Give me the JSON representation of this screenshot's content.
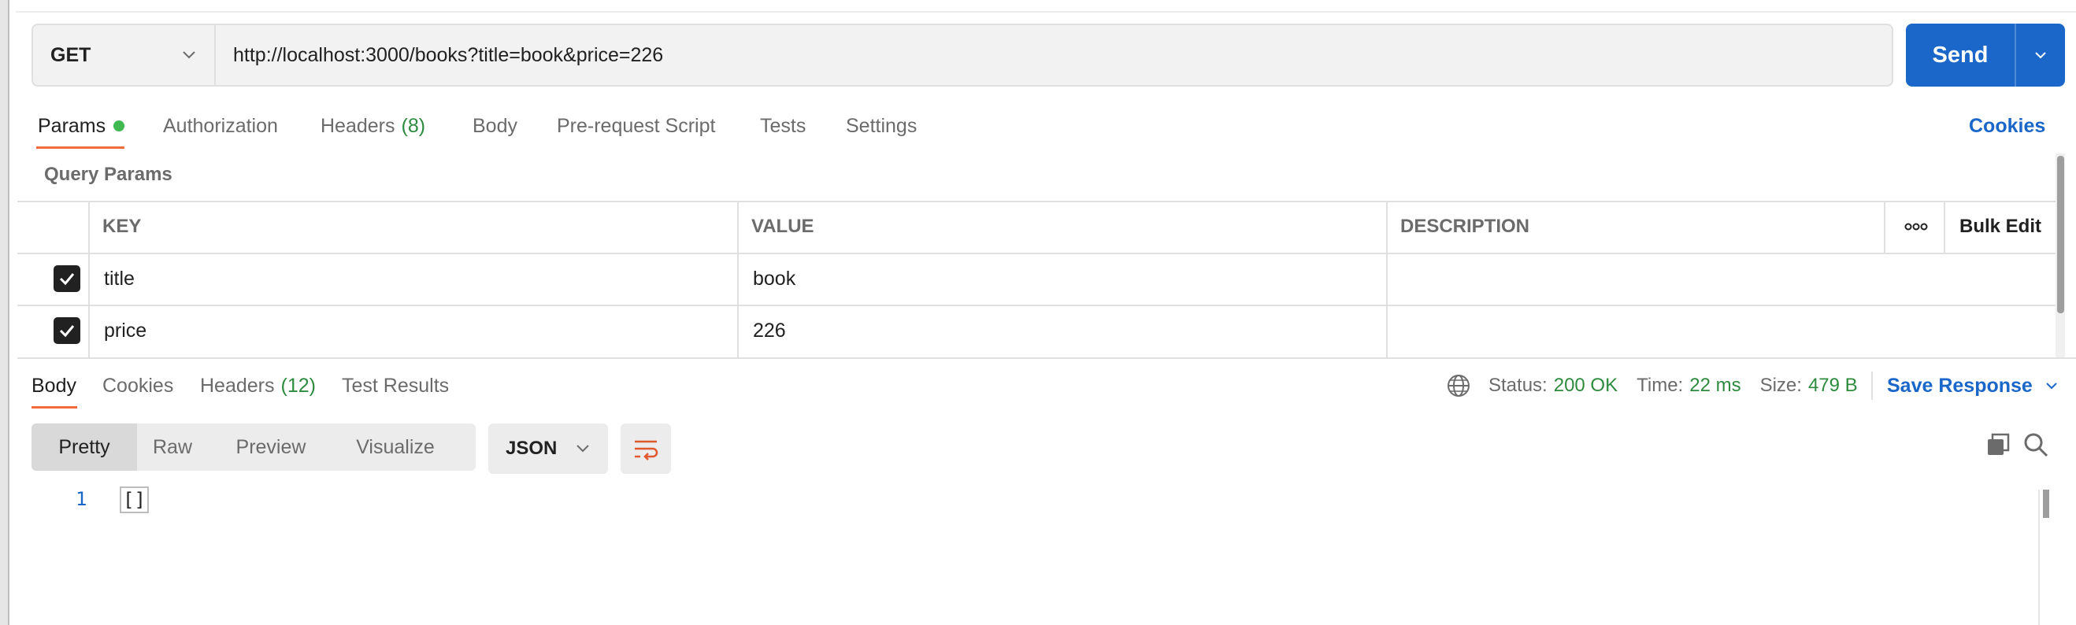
{
  "request": {
    "method": "GET",
    "url": "http://localhost:3000/books?title=book&price=226",
    "send_label": "Send"
  },
  "request_tabs": [
    {
      "label": "Params",
      "active": true,
      "has_dot": true
    },
    {
      "label": "Authorization"
    },
    {
      "label": "Headers",
      "count": "(8)"
    },
    {
      "label": "Body"
    },
    {
      "label": "Pre-request Script"
    },
    {
      "label": "Tests"
    },
    {
      "label": "Settings"
    }
  ],
  "cookies_label": "Cookies",
  "query_params": {
    "label": "Query Params",
    "headers": {
      "key": "KEY",
      "value": "VALUE",
      "description": "DESCRIPTION",
      "bulk_edit": "Bulk Edit"
    },
    "rows": [
      {
        "checked": true,
        "key": "title",
        "value": "book",
        "description": ""
      },
      {
        "checked": true,
        "key": "price",
        "value": "226",
        "description": ""
      }
    ]
  },
  "response_tabs": [
    {
      "label": "Body",
      "active": true
    },
    {
      "label": "Cookies"
    },
    {
      "label": "Headers",
      "count": "(12)"
    },
    {
      "label": "Test Results"
    }
  ],
  "response_status": {
    "status_label": "Status:",
    "status_value": "200 OK",
    "time_label": "Time:",
    "time_value": "22 ms",
    "size_label": "Size:",
    "size_value": "479 B",
    "save_label": "Save Response"
  },
  "view_modes": [
    "Pretty",
    "Raw",
    "Preview",
    "Visualize"
  ],
  "active_view": "Pretty",
  "format": "JSON",
  "code": {
    "line_number": "1",
    "content": "[]"
  },
  "colors": {
    "accent": "#1a67c9",
    "tab_indicator": "#f26b3a",
    "success": "#2e8b3e",
    "dot": "#3fb950"
  },
  "icons": [
    "chevron-down-icon",
    "globe-icon",
    "wrap-lines-icon",
    "copy-icon",
    "search-icon",
    "more-icon",
    "checkbox-checked-icon"
  ]
}
